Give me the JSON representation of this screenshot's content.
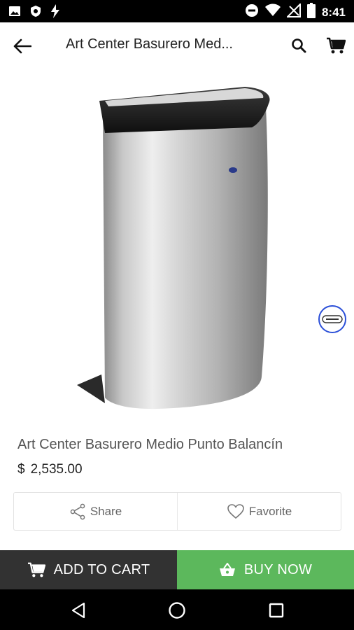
{
  "status_bar": {
    "time": "8:41",
    "left_icons": [
      "image-icon",
      "shield-icon",
      "flash-icon"
    ],
    "right_icons": [
      "do-not-disturb-icon",
      "wifi-icon",
      "no-signal-icon",
      "battery-icon"
    ]
  },
  "app_bar": {
    "title": "Art Center Basurero Med...",
    "back_icon": "arrow-back-icon",
    "search_icon": "search-icon",
    "cart_icon": "cart-icon"
  },
  "product": {
    "image_alt": "stainless-steel-half-round-trash-bin",
    "name": "Art Center Basurero Medio Punto Balancín",
    "currency": "$",
    "price": "2,535.00"
  },
  "actions": {
    "share_label": "Share",
    "favorite_label": "Favorite"
  },
  "bottom_bar": {
    "add_to_cart_label": "ADD TO CART",
    "buy_now_label": "BUY NOW",
    "add_to_cart_color": "#323232",
    "buy_now_color": "#5cb85c"
  },
  "nav_bar": {
    "back": "nav-back-icon",
    "home": "nav-home-icon",
    "recents": "nav-recents-icon"
  }
}
